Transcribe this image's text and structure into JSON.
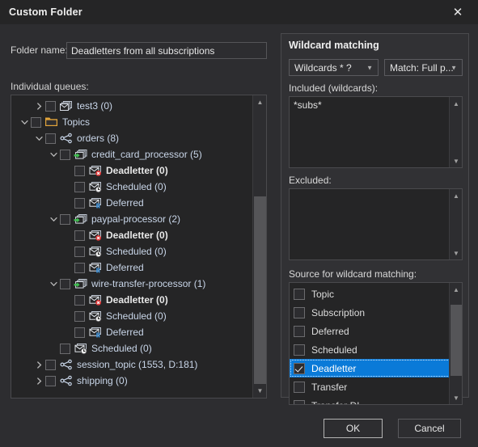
{
  "window": {
    "title": "Custom Folder",
    "close_label": "✕"
  },
  "left": {
    "folder_name_label": "Folder name:",
    "folder_name_value": "Deadletters from all subscriptions",
    "folder_name_placeholder": "",
    "individual_queues_label": "Individual queues:",
    "tree": [
      {
        "indent": 2,
        "twisty": "right",
        "icon": "queue-icon",
        "label": "test3 (0)",
        "bold": false
      },
      {
        "indent": 1,
        "twisty": "down",
        "icon": "folder-icon",
        "label": "Topics",
        "bold": false
      },
      {
        "indent": 2,
        "twisty": "down",
        "icon": "topic-icon",
        "label": "orders (8)",
        "bold": false
      },
      {
        "indent": 3,
        "twisty": "down",
        "icon": "subscription-icon",
        "label": "credit_card_processor (5)",
        "bold": false
      },
      {
        "indent": 4,
        "twisty": "none",
        "icon": "deadletter-icon",
        "label": "Deadletter (0)",
        "bold": true
      },
      {
        "indent": 4,
        "twisty": "none",
        "icon": "scheduled-icon",
        "label": "Scheduled (0)",
        "bold": false
      },
      {
        "indent": 4,
        "twisty": "none",
        "icon": "deferred-icon",
        "label": "Deferred",
        "bold": false
      },
      {
        "indent": 3,
        "twisty": "down",
        "icon": "subscription-icon",
        "label": "paypal-processor (2)",
        "bold": false
      },
      {
        "indent": 4,
        "twisty": "none",
        "icon": "deadletter-icon",
        "label": "Deadletter (0)",
        "bold": true
      },
      {
        "indent": 4,
        "twisty": "none",
        "icon": "scheduled-icon",
        "label": "Scheduled (0)",
        "bold": false
      },
      {
        "indent": 4,
        "twisty": "none",
        "icon": "deferred-icon",
        "label": "Deferred",
        "bold": false
      },
      {
        "indent": 3,
        "twisty": "down",
        "icon": "subscription-icon",
        "label": "wire-transfer-processor (1)",
        "bold": false
      },
      {
        "indent": 4,
        "twisty": "none",
        "icon": "deadletter-icon",
        "label": "Deadletter (0)",
        "bold": true
      },
      {
        "indent": 4,
        "twisty": "none",
        "icon": "scheduled-icon",
        "label": "Scheduled (0)",
        "bold": false
      },
      {
        "indent": 4,
        "twisty": "none",
        "icon": "deferred-icon",
        "label": "Deferred",
        "bold": false
      },
      {
        "indent": 3,
        "twisty": "none",
        "icon": "scheduled-icon",
        "label": "Scheduled (0)",
        "bold": false
      },
      {
        "indent": 2,
        "twisty": "right",
        "icon": "topic-icon",
        "label": "session_topic (1553, D:181)",
        "bold": false
      },
      {
        "indent": 2,
        "twisty": "right",
        "icon": "topic-icon",
        "label": "shipping (0)",
        "bold": false
      }
    ]
  },
  "wildcard": {
    "group_title": "Wildcard matching",
    "wildcards_dropdown": "Wildcards * ?",
    "match_dropdown": "Match: Full p...",
    "included_label": "Included (wildcards):",
    "included_value": "*subs*",
    "excluded_label": "Excluded:",
    "excluded_value": "",
    "source_label": "Source for wildcard matching:",
    "source_items": [
      {
        "label": "Topic",
        "checked": false,
        "selected": false
      },
      {
        "label": "Subscription",
        "checked": false,
        "selected": false
      },
      {
        "label": "Deferred",
        "checked": false,
        "selected": false
      },
      {
        "label": "Scheduled",
        "checked": false,
        "selected": false
      },
      {
        "label": "Deadletter",
        "checked": true,
        "selected": true
      },
      {
        "label": "Transfer",
        "checked": false,
        "selected": false
      },
      {
        "label": "Transfer DL",
        "checked": false,
        "selected": false
      }
    ]
  },
  "footer": {
    "ok_label": "OK",
    "cancel_label": "Cancel"
  },
  "colors": {
    "dialog_bg": "#2d2d30",
    "titlebar_bg": "#252526",
    "field_bg": "#252526",
    "selection_blue": "#0a7ad8",
    "link_text": "#c9d6e9",
    "deadletter_red": "#e03a3a",
    "folder_orange": "#e2a43a",
    "arrow_green": "#3fbf4f",
    "deferred_blue": "#3a8fd8"
  }
}
